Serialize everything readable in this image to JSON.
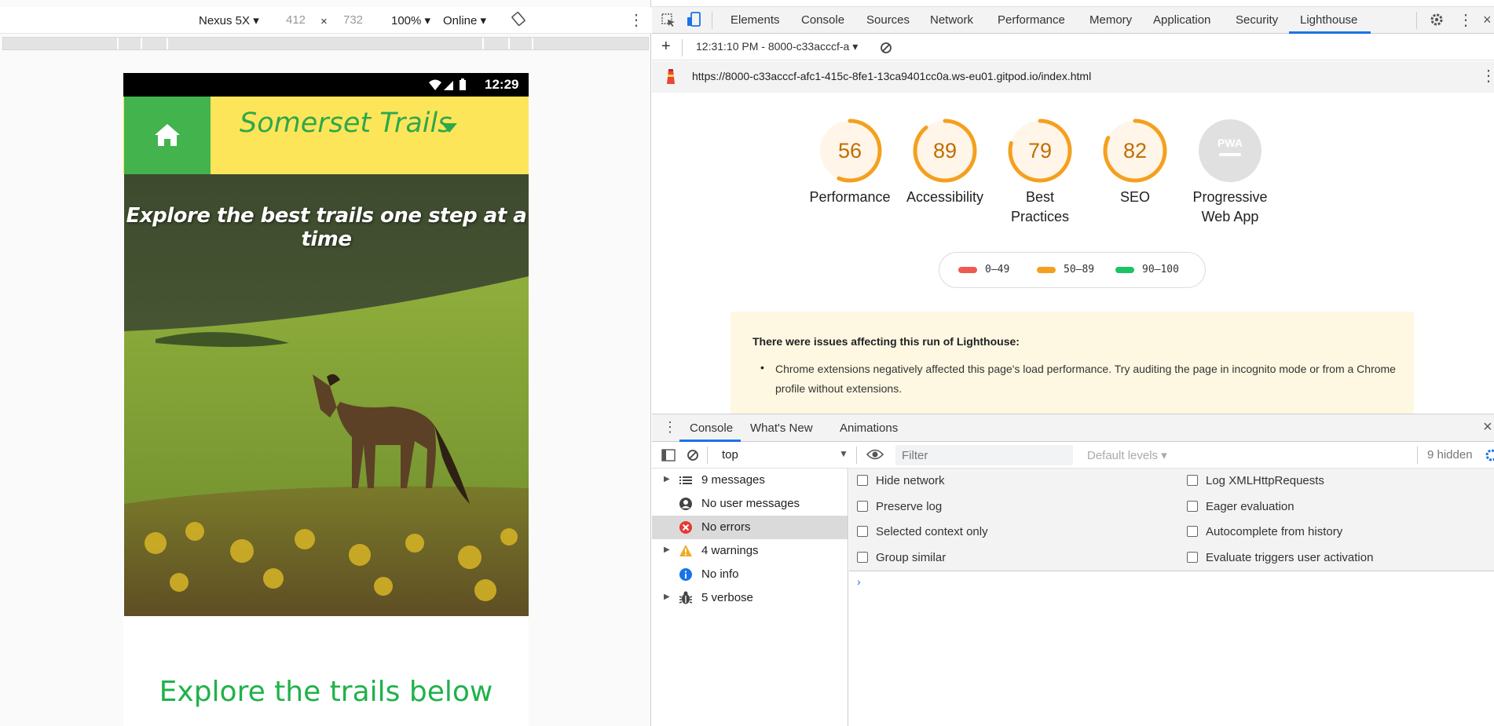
{
  "device_toolbar": {
    "device": "Nexus 5X",
    "width": "412",
    "times": "×",
    "height": "732",
    "zoom": "100%",
    "network": "Online"
  },
  "phone": {
    "time": "12:29",
    "brand": "Somerset Trails",
    "hero_title": "Explore the best trails one step at a time",
    "explore_heading": "Explore the trails below"
  },
  "devtools": {
    "tabs": [
      "Elements",
      "Console",
      "Sources",
      "Network",
      "Performance",
      "Memory",
      "Application",
      "Security",
      "Lighthouse"
    ],
    "active_tab": "Lighthouse",
    "report_select": "12:31:10 PM - 8000-c33acccf-a",
    "url": "https://8000-c33acccf-afc1-415c-8fe1-13ca9401cc0a.ws-eu01.gitpod.io/index.html"
  },
  "lighthouse": {
    "scores": [
      {
        "label": "Performance",
        "value": "56",
        "color": "#f4a01f"
      },
      {
        "label": "Accessibility",
        "value": "89",
        "color": "#f4a01f"
      },
      {
        "label": "Best Practices",
        "value": "79",
        "color": "#f4a01f"
      },
      {
        "label": "SEO",
        "value": "82",
        "color": "#f4a01f"
      }
    ],
    "pwa_label": "Progressive Web App",
    "pwa_badge": "PWA",
    "legend": [
      {
        "range": "0–49",
        "color": "#ee5a52"
      },
      {
        "range": "50–89",
        "color": "#f4a01f"
      },
      {
        "range": "90–100",
        "color": "#1ac464"
      }
    ],
    "warning_title": "There were issues affecting this run of Lighthouse:",
    "warning_item": "Chrome extensions negatively affected this page's load performance. Try auditing the page in incognito mode or from a Chrome profile without extensions."
  },
  "drawer": {
    "tabs": [
      "Console",
      "What's New",
      "Animations"
    ],
    "active": "Console"
  },
  "console_toolbar": {
    "context": "top",
    "filter_placeholder": "Filter",
    "levels": "Default levels",
    "hidden": "9 hidden"
  },
  "console_sidebar": [
    {
      "label": "9 messages",
      "icon": "list-icon",
      "expandable": true
    },
    {
      "label": "No user messages",
      "icon": "user-icon",
      "expandable": false
    },
    {
      "label": "No errors",
      "icon": "error-icon",
      "expandable": false,
      "selected": true
    },
    {
      "label": "4 warnings",
      "icon": "warning-icon",
      "expandable": true
    },
    {
      "label": "No info",
      "icon": "info-icon",
      "expandable": false
    },
    {
      "label": "5 verbose",
      "icon": "bug-icon",
      "expandable": true
    }
  ],
  "console_settings": {
    "left": [
      "Hide network",
      "Preserve log",
      "Selected context only",
      "Group similar"
    ],
    "right": [
      "Log XMLHttpRequests",
      "Eager evaluation",
      "Autocomplete from history",
      "Evaluate triggers user activation"
    ]
  },
  "colors": {
    "brand_green": "#43b34d",
    "nav_yellow": "#fde55a",
    "heading_green": "#1fb24a",
    "active_tab": "#1a73e8"
  }
}
